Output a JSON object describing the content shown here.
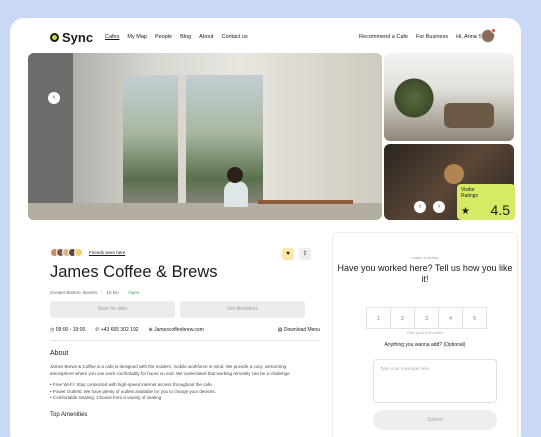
{
  "app": {
    "logo_text": "Sync"
  },
  "nav": {
    "links": [
      "Cafes",
      "My Map",
      "People",
      "Blog",
      "About",
      "Contact us"
    ],
    "active": "Cafes",
    "right_links": [
      "Recommend a Cafe",
      "For Business",
      "Hi, Anna Smith!"
    ]
  },
  "hero": {
    "rating_label": "Visitor Ratings",
    "rating_value": "4.5",
    "prev_icon": "chevron-left-icon",
    "next_icon": "chevron-right-icon"
  },
  "cafe": {
    "friends_label": "Friends were here",
    "name": "James Coffee & Brews",
    "location": "Greater Boston, Boston",
    "distance": "15 km",
    "status": "Open",
    "buttons": [
      "Save for later",
      "Get directions"
    ],
    "hours": "09:00 - 19:00",
    "phone": "+43 665 302 192",
    "website": "Jamescoffeebrew.com",
    "menu": "Download Menu",
    "about_heading": "About",
    "about_text": "James Brews & Coffee is a cafe is designed with the modern, mobile workforce in mind. We provide a cozy, welcoming atmosphere where you can work comfortably for hours on end. We understand that working remotely can be a challenge",
    "bullets": [
      "Free Wi-Fi: Stay connected with high-speed internet access throughout the cafe.",
      "Power Outlets: We have plenty of outlets available for you to charge your devices.",
      "Comfortable Seating: Choose from a variety of seating"
    ],
    "amenities_heading": "Top Amenities"
  },
  "review": {
    "label": "Leave a review",
    "question": "Have you worked here? Tell us how you like it!",
    "scale": [
      "1",
      "2",
      "3",
      "4",
      "5"
    ],
    "scale_hint": "From good to Excellent",
    "add_question": "Anything you wanna add? (Optional)",
    "placeholder": "Type your message here",
    "submit": "Submit"
  },
  "colors": {
    "accent": "#d6ea66",
    "background": "#c9d9f5",
    "open": "#3ba34f"
  }
}
